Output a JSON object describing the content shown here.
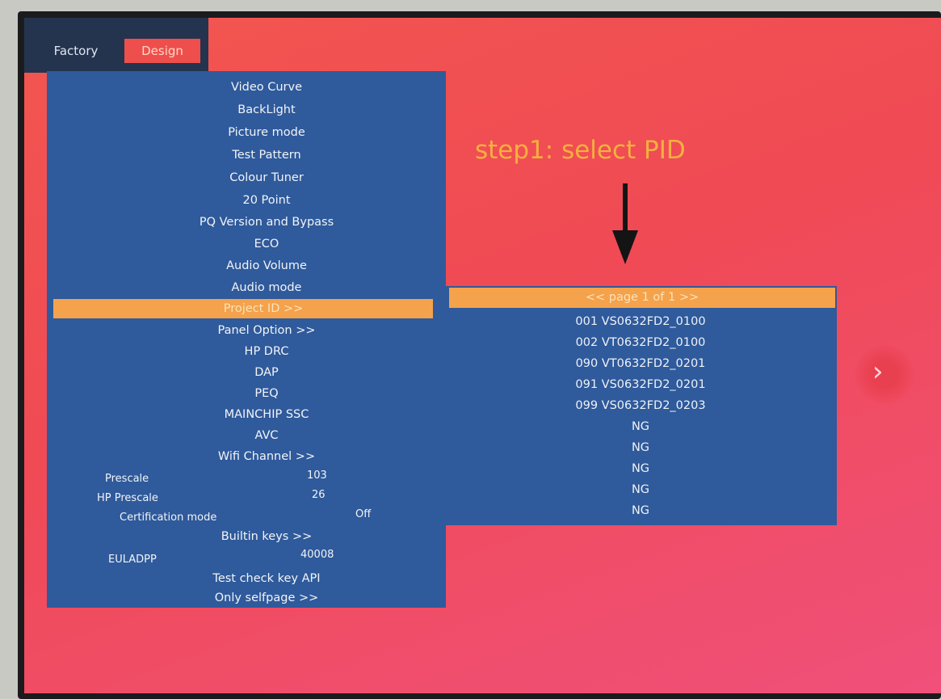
{
  "tabs": {
    "factory": "Factory",
    "design": "Design"
  },
  "annotation": "step1: select PID",
  "menu": {
    "items": [
      "Video Curve",
      "BackLight",
      "Picture mode",
      "Test Pattern",
      "Colour Tuner",
      "20 Point",
      "PQ Version and Bypass",
      "ECO",
      "Audio Volume",
      "Audio mode",
      "Project ID >>",
      "Panel Option >>",
      "HP DRC",
      "DAP",
      "PEQ",
      "MAINCHIP SSC",
      "AVC",
      "Wifi Channel >>"
    ],
    "selected_index": 10,
    "prescale": {
      "label": "Prescale",
      "value": "103"
    },
    "hp_prescale": {
      "label": "HP Prescale",
      "value": "26"
    },
    "certification_mode": {
      "label": "Certification mode",
      "value": "Off"
    },
    "builtin_keys": "Builtin keys >>",
    "euladpp": {
      "label": "EULADPP",
      "value": "40008"
    },
    "test_check_key_api": "Test check key API",
    "only_selfpage": "Only selfpage >>"
  },
  "pid_panel": {
    "header": "<< page 1 of 1 >>",
    "rows": [
      "001 VS0632FD2_0100",
      "002 VT0632FD2_0100",
      "090 VT0632FD2_0201",
      "091 VS0632FD2_0201",
      "099 VS0632FD2_0203",
      "NG",
      "NG",
      "NG",
      "NG",
      "NG"
    ]
  },
  "colors": {
    "menu_bg": "#2f5a9b",
    "highlight": "#f4a24c",
    "annotation": "#f5b03f",
    "screen_bg": "#f2564f"
  },
  "icons": {
    "down_arrow": "arrow-down-icon",
    "next": "chevron-right-icon"
  }
}
